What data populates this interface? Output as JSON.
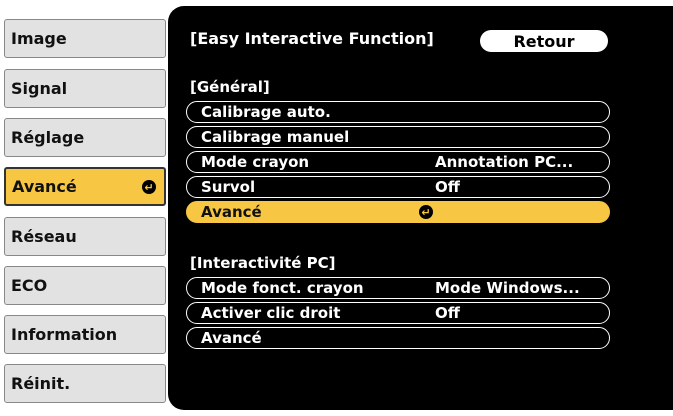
{
  "sidebar": {
    "items": [
      {
        "label": "Image"
      },
      {
        "label": "Signal"
      },
      {
        "label": "Réglage"
      },
      {
        "label": "Avancé",
        "active": true
      },
      {
        "label": "Réseau"
      },
      {
        "label": "ECO"
      },
      {
        "label": "Information"
      },
      {
        "label": "Réinit."
      }
    ],
    "enter_glyph": "↵"
  },
  "panel": {
    "title": "[Easy Interactive Function]",
    "back_label": "Retour",
    "sections": [
      {
        "heading": "[Général]",
        "rows": [
          {
            "label": "Calibrage auto.",
            "value": ""
          },
          {
            "label": "Calibrage manuel",
            "value": ""
          },
          {
            "label": "Mode crayon",
            "value": "Annotation PC..."
          },
          {
            "label": "Survol",
            "value": "Off"
          },
          {
            "label": "Avancé",
            "value": "",
            "selected": true
          }
        ]
      },
      {
        "heading": "[Interactivité PC]",
        "rows": [
          {
            "label": "Mode fonct. crayon",
            "value": "Mode Windows..."
          },
          {
            "label": "Activer clic droit",
            "value": "Off"
          },
          {
            "label": "Avancé",
            "value": ""
          }
        ]
      }
    ]
  },
  "colors": {
    "accent": "#f7c743",
    "panel_bg": "#000000",
    "sidebar_btn": "#e2e2e2"
  }
}
